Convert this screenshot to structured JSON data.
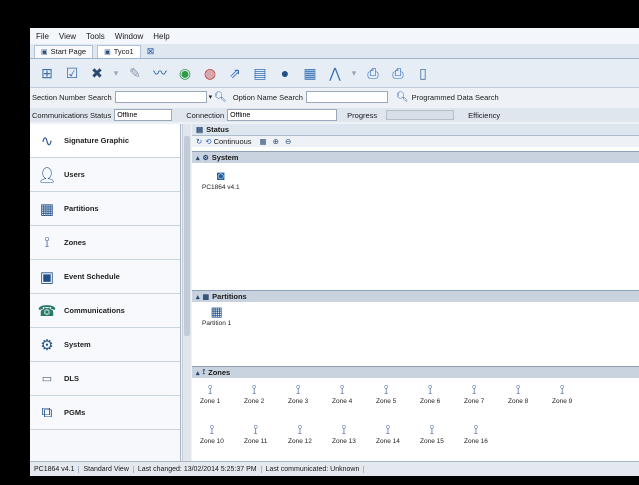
{
  "menu": [
    "File",
    "View",
    "Tools",
    "Window",
    "Help"
  ],
  "tabs": [
    {
      "label": "Start Page"
    },
    {
      "label": "Tyco1"
    }
  ],
  "search": {
    "section_label": "Section Number Search",
    "option_label": "Option Name Search",
    "programmed_label": "Programmed Data Search"
  },
  "comm": {
    "status_label": "Communications Status",
    "status_value": "Offline",
    "connection_label": "Connection",
    "connection_value": "Offline",
    "progress_label": "Progress",
    "efficiency_label": "Efficiency"
  },
  "sidebar": {
    "items": [
      {
        "label": "Signature Graphic",
        "icon": "waveform-icon"
      },
      {
        "label": "Users",
        "icon": "user-icon"
      },
      {
        "label": "Partitions",
        "icon": "partition-icon"
      },
      {
        "label": "Zones",
        "icon": "zone-icon"
      },
      {
        "label": "Event Schedule",
        "icon": "calendar-icon"
      },
      {
        "label": "Communications",
        "icon": "communications-icon"
      },
      {
        "label": "System",
        "icon": "gears-icon"
      },
      {
        "label": "DLS",
        "icon": "dls-icon"
      },
      {
        "label": "PGMs",
        "icon": "pgm-icon"
      }
    ]
  },
  "main": {
    "status_title": "Status",
    "continuous_label": "Continuous",
    "system_title": "System",
    "system_device": "PC1864 v4.1",
    "partitions_title": "Partitions",
    "partition_item": "Partition 1",
    "zones_title": "Zones",
    "zones": [
      "Zone 1",
      "Zone 2",
      "Zone 3",
      "Zone 4",
      "Zone 5",
      "Zone 6",
      "Zone 7",
      "Zone 8",
      "Zone 9",
      "Zone 10",
      "Zone 11",
      "Zone 12",
      "Zone 13",
      "Zone 14",
      "Zone 15",
      "Zone 16"
    ]
  },
  "statusbar": {
    "device": "PC1864 v4.1",
    "view": "Standard View",
    "last_changed": "Last changed: 13/02/2014 5:25:37 PM",
    "last_communicated": "Last communicated: Unknown"
  },
  "colors": {
    "accent": "#2a5a9a",
    "section_header": "#c9d3df",
    "sidebar_bg": "#f6f8fb"
  }
}
